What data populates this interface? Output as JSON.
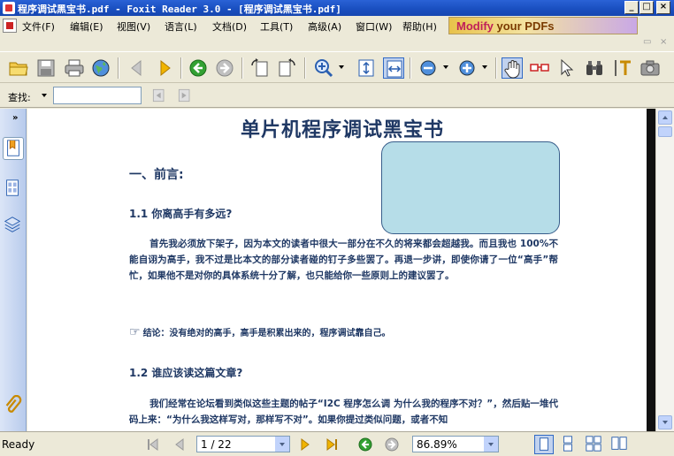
{
  "window": {
    "title": "程序调试黑宝书.pdf - Foxit Reader 3.0 - [程序调试黑宝书.pdf]",
    "minimize": "_",
    "maximize": "□",
    "close": "×"
  },
  "menu": {
    "items": [
      "文件(F)",
      "编辑(E)",
      "视图(V)",
      "语言(L)",
      "文档(D)",
      "工具(T)",
      "高级(A)",
      "窗口(W)",
      "帮助(H)"
    ],
    "ad_text_1": "Modify",
    "ad_text_2": " your PDFs"
  },
  "mdi": {
    "restore": "▭",
    "close": "×"
  },
  "findbar": {
    "label": "查找:",
    "input_value": ""
  },
  "document": {
    "title": "单片机程序调试黑宝书",
    "section": "一、前言:",
    "q1": "1.1 你离高手有多远?",
    "p1": "首先我必须放下架子，因为本文的读者中很大一部分在不久的将来都会超越我。而且我也 100%不能自诩为高手，我不过是比本文的部分读者碰的钉子多些罢了。再退一步讲，即使你请了一位“高手”帮忙，如果他不是对你的具体系统十分了解，也只能给你一些原则上的建议罢了。",
    "note": "结论：没有绝对的高手，高手是积累出来的，程序调试靠自己。",
    "note_icon": "pointing-hand-icon",
    "q2": "1.2 谁应该读这篇文章?",
    "p2": "我们经常在论坛看到类似这些主题的帖子“I2C 程序怎么调 为什么我的程序不对？”，然后贴一堆代码上来：“为什么我这样写对，那样写不对”。如果你提过类似问题，或者不知"
  },
  "statusbar": {
    "ready": "Ready",
    "page_value": "1 / 22",
    "zoom_value": "86.89%"
  },
  "colors": {
    "title_bar": "#1a4fc0",
    "doc_text": "#1f3864",
    "shape_fill": "#b6dde8",
    "shape_border": "#385d8a"
  }
}
